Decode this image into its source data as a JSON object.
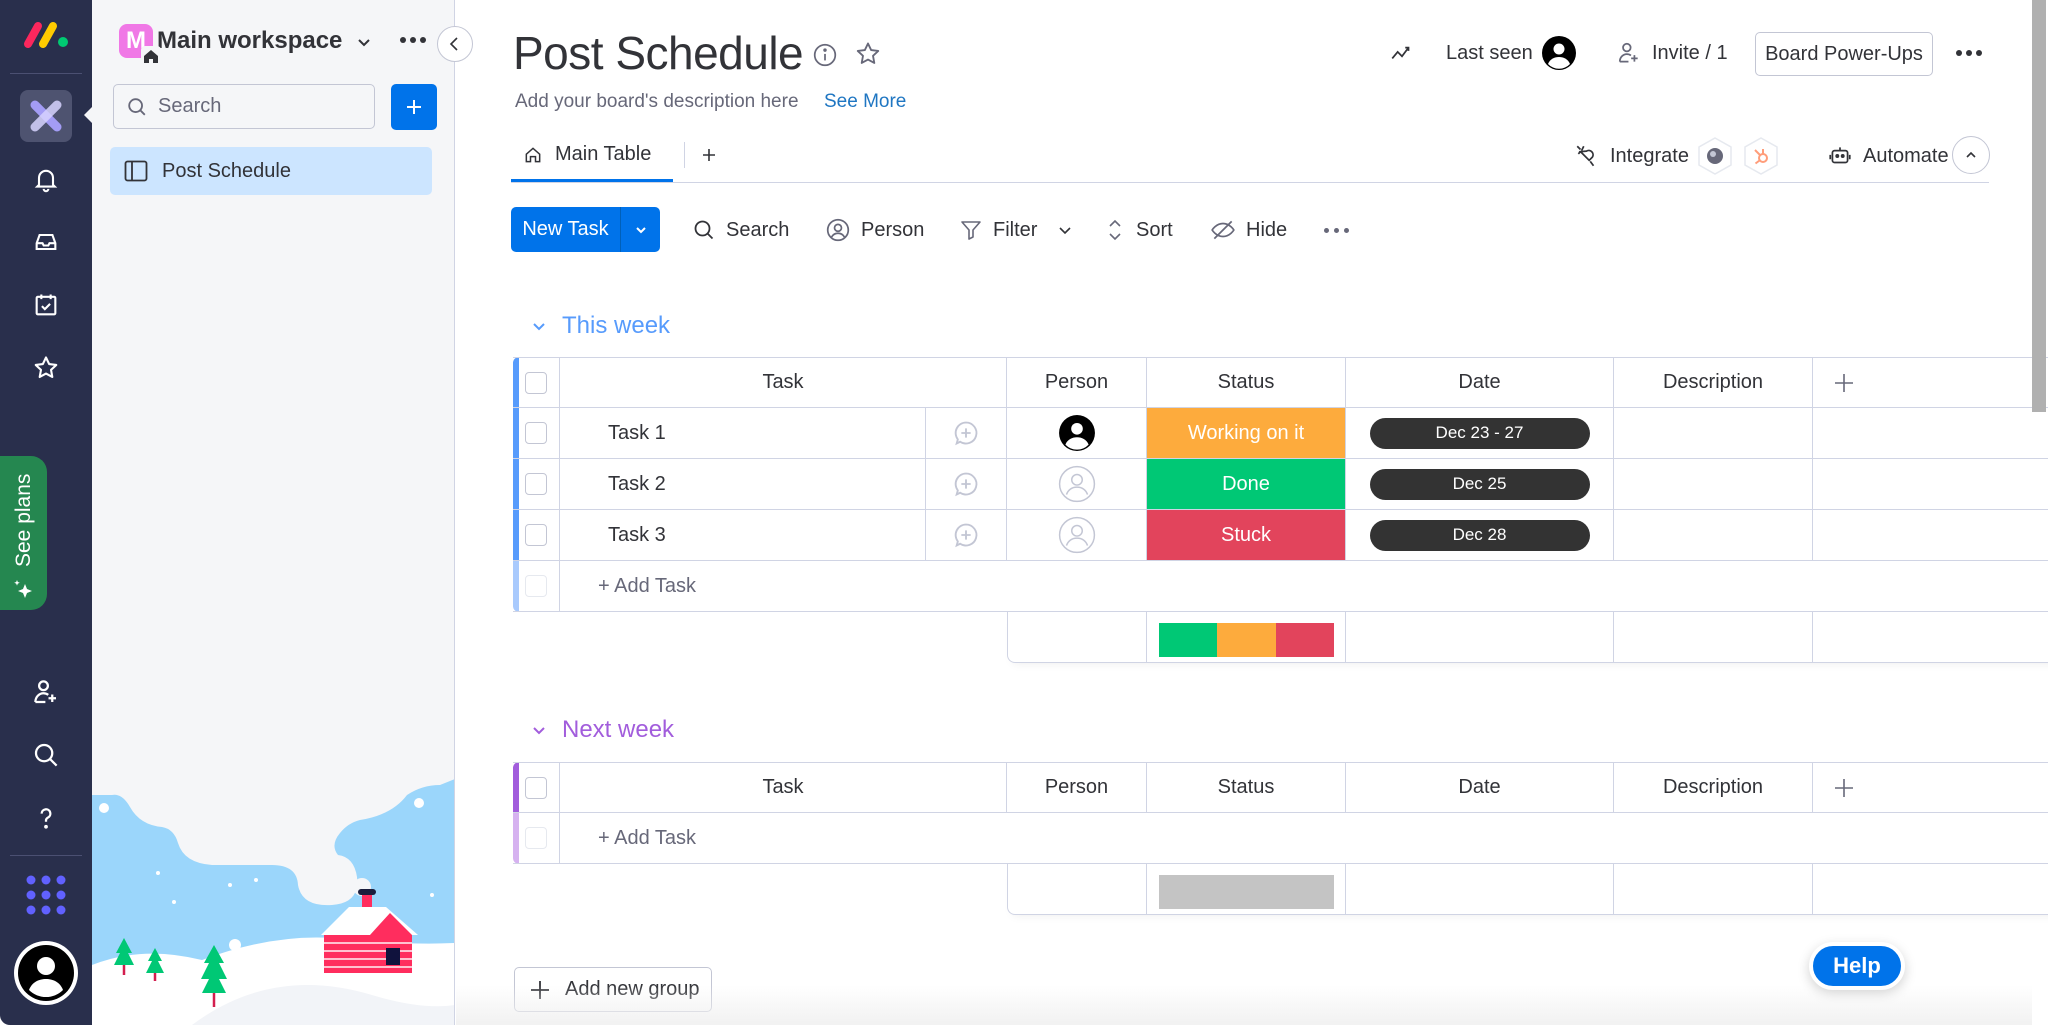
{
  "rail": {
    "items": [
      {
        "name": "work-management",
        "icon": "work-management-icon"
      },
      {
        "name": "notifications",
        "icon": "bell-icon"
      },
      {
        "name": "inbox",
        "icon": "inbox-icon"
      },
      {
        "name": "my-work",
        "icon": "calendar-check-icon"
      },
      {
        "name": "favorites",
        "icon": "star-icon"
      },
      {
        "name": "invite-members",
        "icon": "person-plus-icon"
      },
      {
        "name": "search",
        "icon": "search-icon"
      },
      {
        "name": "help",
        "icon": "question-icon"
      },
      {
        "name": "apps",
        "icon": "grid-dots-icon"
      }
    ],
    "see_plans": "See plans"
  },
  "workspace": {
    "badge_letter": "M",
    "name": "Main workspace",
    "search_placeholder": "Search",
    "boards": [
      {
        "label": "Post Schedule",
        "selected": true
      }
    ]
  },
  "board": {
    "title": "Post Schedule",
    "description": "Add your board's description here",
    "see_more": "See More",
    "last_seen": "Last seen",
    "invite": "Invite / 1",
    "power_ups": "Board Power-Ups",
    "tabs": [
      {
        "label": "Main Table",
        "active": true
      }
    ],
    "integrate": "Integrate",
    "automate": "Automate"
  },
  "toolbar": {
    "new_task": "New Task",
    "search": "Search",
    "person": "Person",
    "filter": "Filter",
    "sort": "Sort",
    "hide": "Hide"
  },
  "columns": {
    "task": "Task",
    "person": "Person",
    "status": "Status",
    "date": "Date",
    "description": "Description"
  },
  "colors": {
    "accent": "#0073ea",
    "working": "#fdab3d",
    "done": "#00c875",
    "stuck": "#e2445c",
    "empty": "#c4c4c4",
    "group_this_week": "#579bfc",
    "group_next_week": "#a25ddc"
  },
  "groups": [
    {
      "title": "This week",
      "color": "#579bfc",
      "rows": [
        {
          "task": "Task 1",
          "person": "assigned",
          "status": "Working on it",
          "status_color": "#fdab3d",
          "date": "Dec 23 - 27",
          "description": ""
        },
        {
          "task": "Task 2",
          "person": "unassigned",
          "status": "Done",
          "status_color": "#00c875",
          "date": "Dec 25",
          "description": ""
        },
        {
          "task": "Task 3",
          "person": "unassigned",
          "status": "Stuck",
          "status_color": "#e2445c",
          "date": "Dec 28",
          "description": ""
        }
      ],
      "add_task": "+ Add Task",
      "status_summary": [
        {
          "label": "Done",
          "fraction": 0.3333,
          "color": "#00c875"
        },
        {
          "label": "Working on it",
          "fraction": 0.3333,
          "color": "#fdab3d"
        },
        {
          "label": "Stuck",
          "fraction": 0.3334,
          "color": "#e2445c"
        }
      ]
    },
    {
      "title": "Next week",
      "color": "#a25ddc",
      "rows": [],
      "add_task": "+ Add Task",
      "status_summary": [
        {
          "label": "Empty",
          "fraction": 1,
          "color": "#c4c4c4"
        }
      ]
    }
  ],
  "add_new_group": "Add new group",
  "help": "Help"
}
